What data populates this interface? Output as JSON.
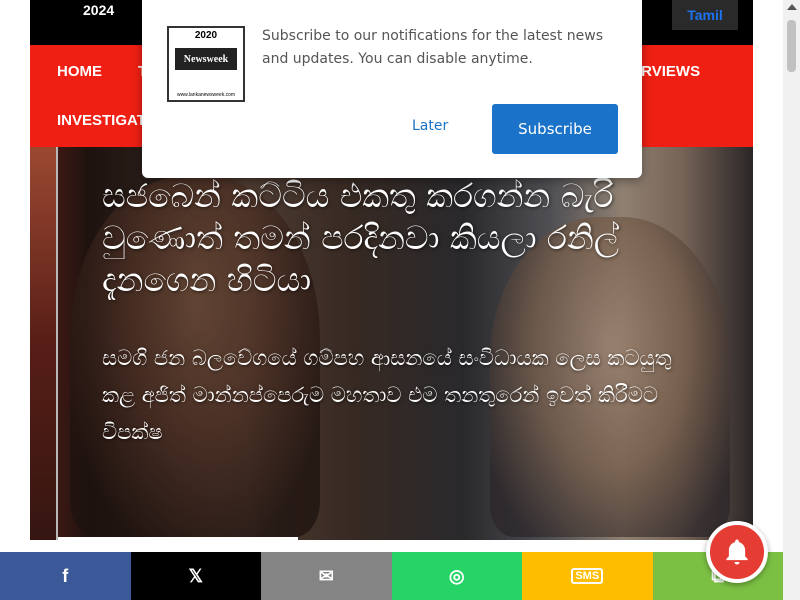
{
  "topbar": {
    "year": "2024",
    "language": "Tamil"
  },
  "nav": {
    "home": "HOME",
    "item_partial": "T",
    "interviews": "TERVIEWS",
    "investigations": "INVESTIGAT"
  },
  "hero": {
    "headline": "සජබෙන් කට්ටිය එකතු කරගන්න බැරි වුණොත් තමන් පරදිනවා කියලා රනිල් දැනගෙන හිටියා",
    "subtext": "සමගි ජන බලවේගයේ ගම්පහ ආසනයේ සංවිධායක ලෙස කටයුතු කළ අජිත් මාන්නප්පෙරුම මහතාව එම තනතුරෙන් ඉවත් කිරීමට විපක්ෂ"
  },
  "popup": {
    "logo": {
      "year": "2020",
      "brand": "Newsweek",
      "url": "www.lankanewsweek.com"
    },
    "message": "Subscribe to our notifications for the latest news and updates. You can disable anytime.",
    "later_label": "Later",
    "subscribe_label": "Subscribe"
  },
  "share": {
    "facebook": "f",
    "x": "𝕏",
    "email": "✉",
    "whatsapp": "◎",
    "sms": "SMS",
    "copy": "⧉"
  },
  "colors": {
    "nav_red": "#ef1f13",
    "subscribe_blue": "#1a73c8",
    "bell_red": "#e53c34",
    "facebook": "#3b5998",
    "x": "#000000",
    "email": "#848484",
    "whatsapp": "#25d366",
    "sms": "#ffbd00",
    "copy": "#7bc043"
  },
  "icons": {
    "bell": "bell-icon",
    "facebook": "facebook-icon",
    "x": "x-icon",
    "email": "email-icon",
    "whatsapp": "whatsapp-icon",
    "sms": "sms-icon",
    "copy": "copy-icon"
  }
}
